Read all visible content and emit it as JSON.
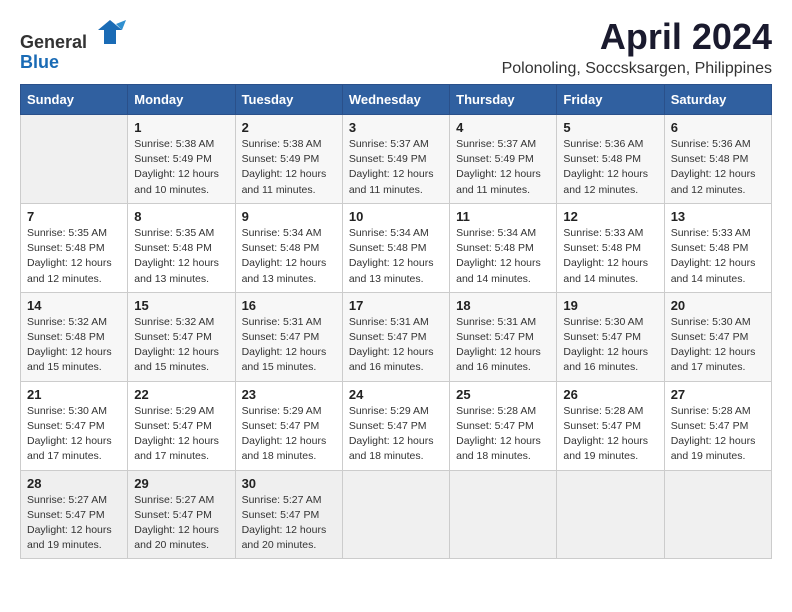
{
  "header": {
    "logo_general": "General",
    "logo_blue": "Blue",
    "title": "April 2024",
    "subtitle": "Polonoling, Soccsksargen, Philippines"
  },
  "calendar": {
    "days_of_week": [
      "Sunday",
      "Monday",
      "Tuesday",
      "Wednesday",
      "Thursday",
      "Friday",
      "Saturday"
    ],
    "weeks": [
      [
        {
          "day": "",
          "info": ""
        },
        {
          "day": "1",
          "info": "Sunrise: 5:38 AM\nSunset: 5:49 PM\nDaylight: 12 hours\nand 10 minutes."
        },
        {
          "day": "2",
          "info": "Sunrise: 5:38 AM\nSunset: 5:49 PM\nDaylight: 12 hours\nand 11 minutes."
        },
        {
          "day": "3",
          "info": "Sunrise: 5:37 AM\nSunset: 5:49 PM\nDaylight: 12 hours\nand 11 minutes."
        },
        {
          "day": "4",
          "info": "Sunrise: 5:37 AM\nSunset: 5:49 PM\nDaylight: 12 hours\nand 11 minutes."
        },
        {
          "day": "5",
          "info": "Sunrise: 5:36 AM\nSunset: 5:48 PM\nDaylight: 12 hours\nand 12 minutes."
        },
        {
          "day": "6",
          "info": "Sunrise: 5:36 AM\nSunset: 5:48 PM\nDaylight: 12 hours\nand 12 minutes."
        }
      ],
      [
        {
          "day": "7",
          "info": "Sunrise: 5:35 AM\nSunset: 5:48 PM\nDaylight: 12 hours\nand 12 minutes."
        },
        {
          "day": "8",
          "info": "Sunrise: 5:35 AM\nSunset: 5:48 PM\nDaylight: 12 hours\nand 13 minutes."
        },
        {
          "day": "9",
          "info": "Sunrise: 5:34 AM\nSunset: 5:48 PM\nDaylight: 12 hours\nand 13 minutes."
        },
        {
          "day": "10",
          "info": "Sunrise: 5:34 AM\nSunset: 5:48 PM\nDaylight: 12 hours\nand 13 minutes."
        },
        {
          "day": "11",
          "info": "Sunrise: 5:34 AM\nSunset: 5:48 PM\nDaylight: 12 hours\nand 14 minutes."
        },
        {
          "day": "12",
          "info": "Sunrise: 5:33 AM\nSunset: 5:48 PM\nDaylight: 12 hours\nand 14 minutes."
        },
        {
          "day": "13",
          "info": "Sunrise: 5:33 AM\nSunset: 5:48 PM\nDaylight: 12 hours\nand 14 minutes."
        }
      ],
      [
        {
          "day": "14",
          "info": "Sunrise: 5:32 AM\nSunset: 5:48 PM\nDaylight: 12 hours\nand 15 minutes."
        },
        {
          "day": "15",
          "info": "Sunrise: 5:32 AM\nSunset: 5:47 PM\nDaylight: 12 hours\nand 15 minutes."
        },
        {
          "day": "16",
          "info": "Sunrise: 5:31 AM\nSunset: 5:47 PM\nDaylight: 12 hours\nand 15 minutes."
        },
        {
          "day": "17",
          "info": "Sunrise: 5:31 AM\nSunset: 5:47 PM\nDaylight: 12 hours\nand 16 minutes."
        },
        {
          "day": "18",
          "info": "Sunrise: 5:31 AM\nSunset: 5:47 PM\nDaylight: 12 hours\nand 16 minutes."
        },
        {
          "day": "19",
          "info": "Sunrise: 5:30 AM\nSunset: 5:47 PM\nDaylight: 12 hours\nand 16 minutes."
        },
        {
          "day": "20",
          "info": "Sunrise: 5:30 AM\nSunset: 5:47 PM\nDaylight: 12 hours\nand 17 minutes."
        }
      ],
      [
        {
          "day": "21",
          "info": "Sunrise: 5:30 AM\nSunset: 5:47 PM\nDaylight: 12 hours\nand 17 minutes."
        },
        {
          "day": "22",
          "info": "Sunrise: 5:29 AM\nSunset: 5:47 PM\nDaylight: 12 hours\nand 17 minutes."
        },
        {
          "day": "23",
          "info": "Sunrise: 5:29 AM\nSunset: 5:47 PM\nDaylight: 12 hours\nand 18 minutes."
        },
        {
          "day": "24",
          "info": "Sunrise: 5:29 AM\nSunset: 5:47 PM\nDaylight: 12 hours\nand 18 minutes."
        },
        {
          "day": "25",
          "info": "Sunrise: 5:28 AM\nSunset: 5:47 PM\nDaylight: 12 hours\nand 18 minutes."
        },
        {
          "day": "26",
          "info": "Sunrise: 5:28 AM\nSunset: 5:47 PM\nDaylight: 12 hours\nand 19 minutes."
        },
        {
          "day": "27",
          "info": "Sunrise: 5:28 AM\nSunset: 5:47 PM\nDaylight: 12 hours\nand 19 minutes."
        }
      ],
      [
        {
          "day": "28",
          "info": "Sunrise: 5:27 AM\nSunset: 5:47 PM\nDaylight: 12 hours\nand 19 minutes."
        },
        {
          "day": "29",
          "info": "Sunrise: 5:27 AM\nSunset: 5:47 PM\nDaylight: 12 hours\nand 20 minutes."
        },
        {
          "day": "30",
          "info": "Sunrise: 5:27 AM\nSunset: 5:47 PM\nDaylight: 12 hours\nand 20 minutes."
        },
        {
          "day": "",
          "info": ""
        },
        {
          "day": "",
          "info": ""
        },
        {
          "day": "",
          "info": ""
        },
        {
          "day": "",
          "info": ""
        }
      ]
    ]
  }
}
